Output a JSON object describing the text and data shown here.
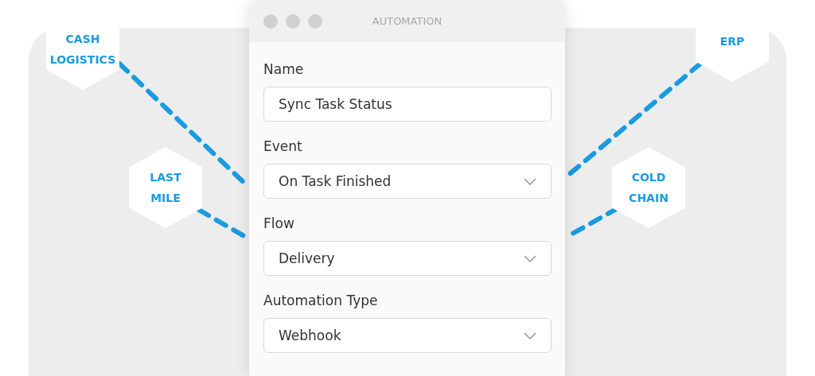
{
  "window": {
    "title": "AUTOMATION"
  },
  "fields": [
    {
      "label": "Name",
      "value": "Sync Task Status",
      "kind": "text"
    },
    {
      "label": "Event",
      "value": "On Task Finished",
      "kind": "select"
    },
    {
      "label": "Flow",
      "value": "Delivery",
      "kind": "select"
    },
    {
      "label": "Automation Type",
      "value": "Webhook",
      "kind": "select"
    }
  ],
  "nodes": [
    {
      "lines": [
        "CASH",
        "LOGISTICS"
      ]
    },
    {
      "lines": [
        "LAST",
        "MILE"
      ]
    },
    {
      "lines": [
        "ERP"
      ]
    },
    {
      "lines": [
        "COLD",
        "CHAIN"
      ]
    }
  ]
}
